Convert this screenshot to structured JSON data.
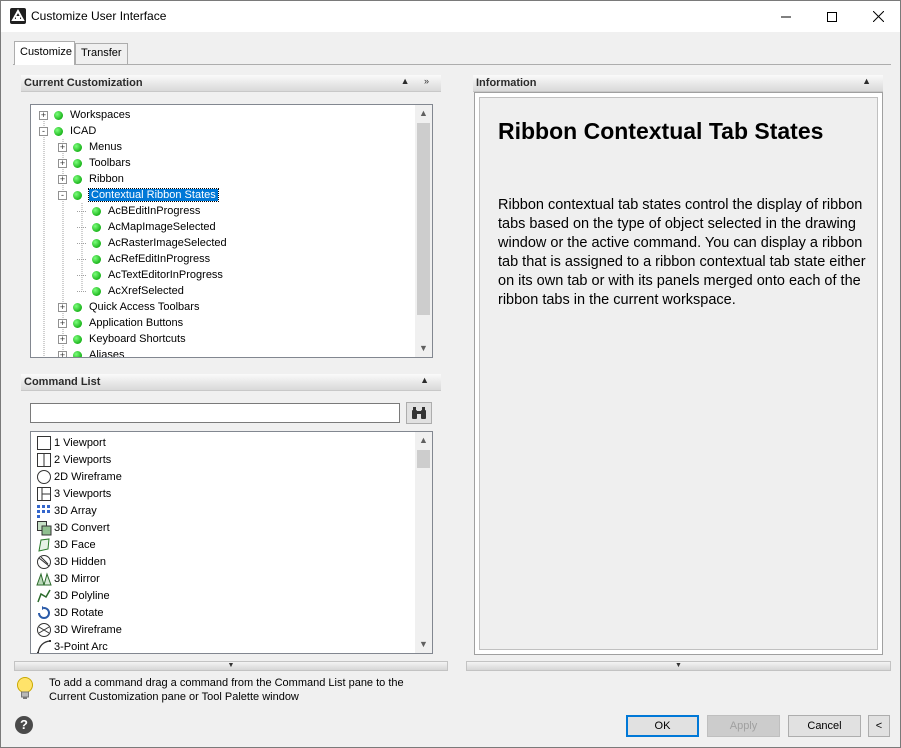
{
  "window": {
    "title": "Customize User Interface",
    "minimize_icon": "minimize-icon",
    "maximize_icon": "maximize-icon",
    "close_icon": "close-icon"
  },
  "tabs": [
    {
      "label": "Customize",
      "active": true
    },
    {
      "label": "Transfer",
      "active": false
    }
  ],
  "current_customization": {
    "header": "Current Customization",
    "tree": [
      {
        "label": "Workspaces",
        "level": 0,
        "expander": "+"
      },
      {
        "label": "ICAD",
        "level": 0,
        "expander": "-"
      },
      {
        "label": "Menus",
        "level": 1,
        "expander": "+"
      },
      {
        "label": "Toolbars",
        "level": 1,
        "expander": "+"
      },
      {
        "label": "Ribbon",
        "level": 1,
        "expander": "+"
      },
      {
        "label": "Contextual Ribbon States",
        "level": 1,
        "expander": "-",
        "selected": true
      },
      {
        "label": "AcBEditInProgress",
        "level": 2,
        "expander": ""
      },
      {
        "label": "AcMapImageSelected",
        "level": 2,
        "expander": ""
      },
      {
        "label": "AcRasterImageSelected",
        "level": 2,
        "expander": ""
      },
      {
        "label": "AcRefEditInProgress",
        "level": 2,
        "expander": ""
      },
      {
        "label": "AcTextEditorInProgress",
        "level": 2,
        "expander": ""
      },
      {
        "label": "AcXrefSelected",
        "level": 2,
        "expander": ""
      },
      {
        "label": "Quick Access Toolbars",
        "level": 1,
        "expander": "+"
      },
      {
        "label": "Application Buttons",
        "level": 1,
        "expander": "+"
      },
      {
        "label": "Keyboard Shortcuts",
        "level": 1,
        "expander": "+"
      },
      {
        "label": "Aliases",
        "level": 1,
        "expander": "+"
      }
    ]
  },
  "command_list": {
    "header": "Command List",
    "search_value": "",
    "search_icon": "binoculars-icon",
    "items": [
      {
        "label": "1 Viewport",
        "icon": "single-viewport-icon"
      },
      {
        "label": "2 Viewports",
        "icon": "two-viewports-icon"
      },
      {
        "label": "2D Wireframe",
        "icon": "wireframe-2d-icon"
      },
      {
        "label": "3 Viewports",
        "icon": "three-viewports-icon"
      },
      {
        "label": "3D Array",
        "icon": "array-3d-icon"
      },
      {
        "label": "3D Convert",
        "icon": "convert-3d-icon"
      },
      {
        "label": "3D Face",
        "icon": "face-3d-icon"
      },
      {
        "label": "3D Hidden",
        "icon": "hidden-3d-icon"
      },
      {
        "label": "3D Mirror",
        "icon": "mirror-3d-icon"
      },
      {
        "label": "3D Polyline",
        "icon": "polyline-3d-icon"
      },
      {
        "label": "3D Rotate",
        "icon": "rotate-3d-icon"
      },
      {
        "label": "3D Wireframe",
        "icon": "wireframe-3d-icon"
      },
      {
        "label": "3-Point Arc",
        "icon": "arc-3point-icon"
      }
    ]
  },
  "information": {
    "header": "Information",
    "title": "Ribbon Contextual Tab States",
    "body": "Ribbon contextual tab states control the display of ribbon tabs based on the type of object selected in the drawing window or the active command. You can display a ribbon tab that is assigned to a ribbon contextual tab state either on its own tab or with its panels merged onto each of the ribbon tabs in the current workspace."
  },
  "hint": {
    "icon": "lightbulb-icon",
    "text": "To add a command drag a command from the Command List pane to the Current Customization pane or Tool Palette window"
  },
  "footer": {
    "help_icon": "help-icon",
    "ok_label": "OK",
    "apply_label": "Apply",
    "cancel_label": "Cancel",
    "collapse_label": "<"
  }
}
